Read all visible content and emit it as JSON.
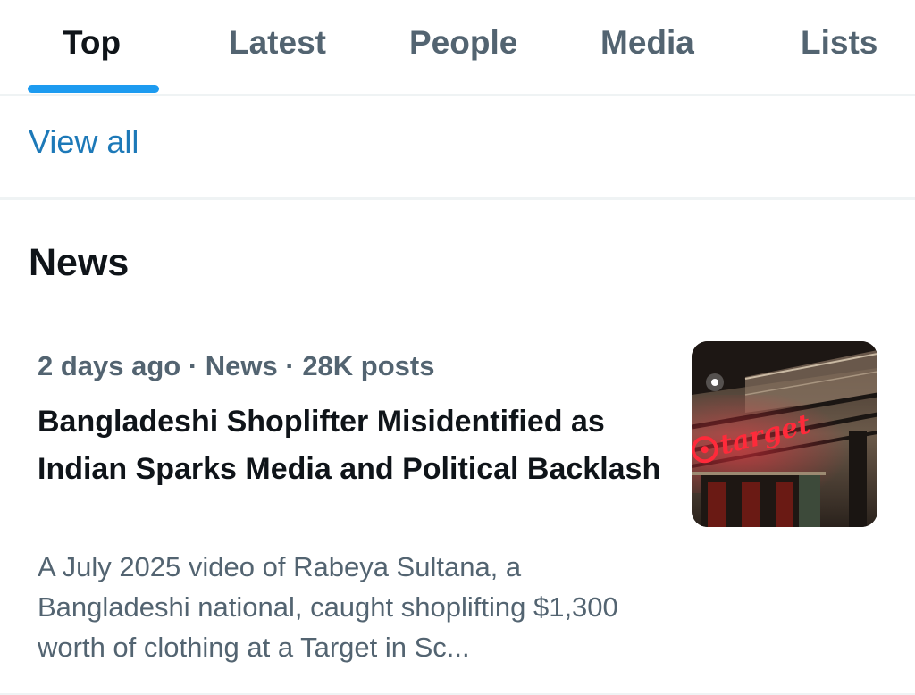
{
  "tabs": [
    {
      "label": "Top",
      "active": true
    },
    {
      "label": "Latest",
      "active": false
    },
    {
      "label": "People",
      "active": false
    },
    {
      "label": "Media",
      "active": false
    },
    {
      "label": "Lists",
      "active": false
    }
  ],
  "view_all_label": "View all",
  "section_title": "News",
  "news_item": {
    "meta": "2 days ago · News · 28K posts",
    "headline": "Bangladeshi Shoplifter Misidentified as Indian Sparks Media and Political Backlash",
    "summary": "A July 2025 video of Rabeya Sultana, a Bangladeshi national, caught shoplifting $1,300 worth of clothing at a Target in Sc...",
    "thumbnail": {
      "sign_text": "target",
      "icon": "store-sign-photo"
    }
  },
  "colors": {
    "accent": "#1d9bf0",
    "link": "#1d79b8",
    "text_primary": "#0f1419",
    "text_secondary": "#536471",
    "sign_red": "#e0182b"
  }
}
